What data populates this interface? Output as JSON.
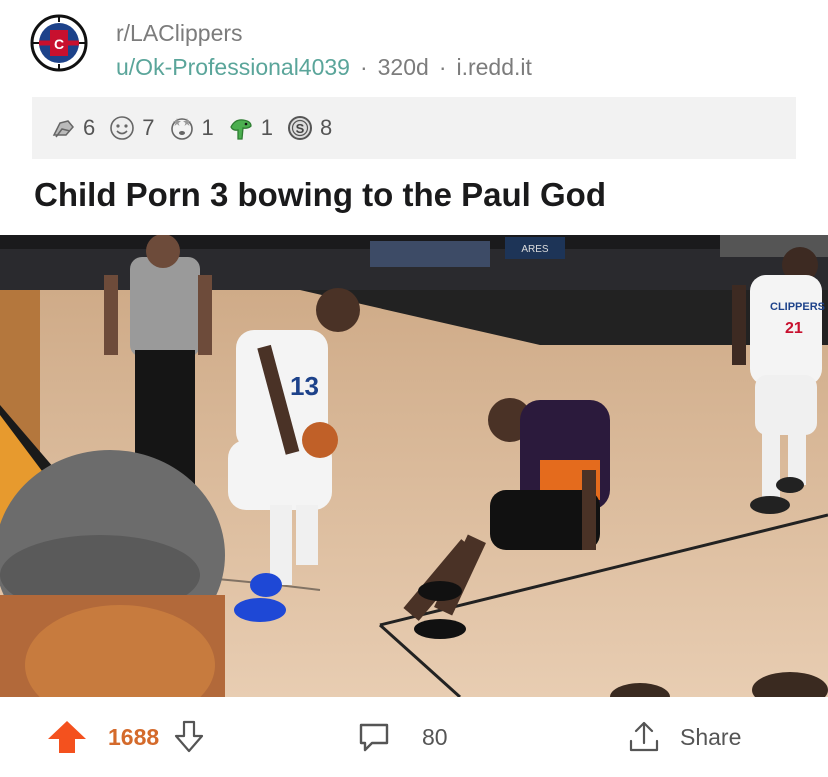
{
  "post": {
    "subreddit": "r/LAClippers",
    "author": "u/Ok-Professional4039",
    "age": "320d",
    "domain": "i.redd.it",
    "title": "Child Porn 3 bowing to the Paul God"
  },
  "awards": [
    {
      "icon": "helping-hand-award-icon",
      "count": "6"
    },
    {
      "icon": "wholesome-face-award-icon",
      "count": "7"
    },
    {
      "icon": "starstruck-award-icon",
      "count": "1"
    },
    {
      "icon": "dinosaur-award-icon",
      "count": "1"
    },
    {
      "icon": "silver-coin-award-icon",
      "count": "8"
    }
  ],
  "media": {
    "jersey_number": "21",
    "jersey_team": "CLIPPERS",
    "arena_sign": "ARES"
  },
  "footer": {
    "score": "1688",
    "comments": "80",
    "share_label": "Share"
  },
  "colors": {
    "upvote": "#f4511e",
    "score": "#d46a2b",
    "username": "#5aa59a",
    "meta_gray": "#7c7c7c"
  }
}
